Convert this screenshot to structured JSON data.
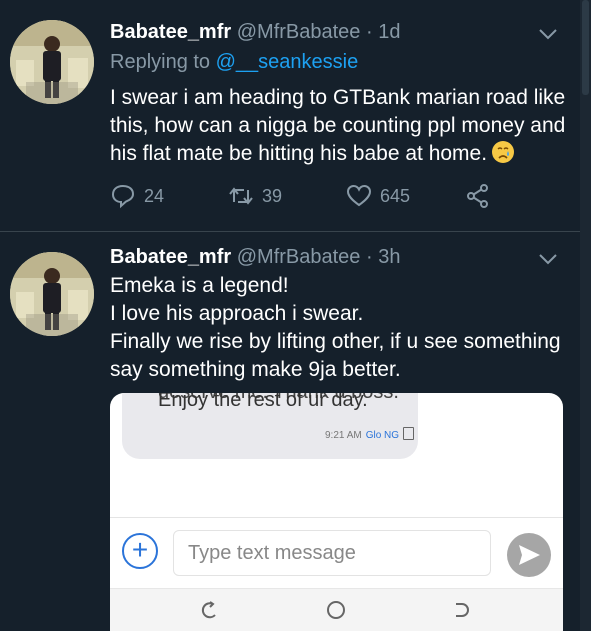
{
  "colors": {
    "background": "#15202b",
    "text": "#ffffff",
    "muted": "#8899a6",
    "link": "#1da1f2",
    "divider": "#38444d"
  },
  "tweets": [
    {
      "name": "Babatee_mfr",
      "handle": "@MfrBabatee",
      "separator": "·",
      "time": "1d",
      "replying_label": "Replying to",
      "replying_to": "@__seankessie",
      "lines": [
        "I swear i am heading to GTBank marian road like",
        "this, how can a nigga be counting ppl money and",
        "his flat mate be hitting his babe at home."
      ],
      "emoji": "crying-face",
      "replies": "24",
      "retweets": "39",
      "likes": "645"
    },
    {
      "name": "Babatee_mfr",
      "handle": "@MfrBabatee",
      "separator": "·",
      "time": "3h",
      "lines": [
        "Emeka is a legend!",
        "I love his approach i swear.",
        "Finally we rise by lifting other, if u see something",
        "say something make 9ja better."
      ]
    }
  ],
  "attached_screenshot": {
    "cut_off_text": "deserve me. Thank u boss.",
    "message_text": "Enjoy the rest of ur day.",
    "message_time": "9:21 AM",
    "carrier": "Glo NG",
    "input_placeholder": "Type text message",
    "icons": {
      "add": "plus-icon",
      "send": "send-icon",
      "nav": [
        "recent-apps-icon",
        "home-icon",
        "back-icon"
      ]
    }
  }
}
